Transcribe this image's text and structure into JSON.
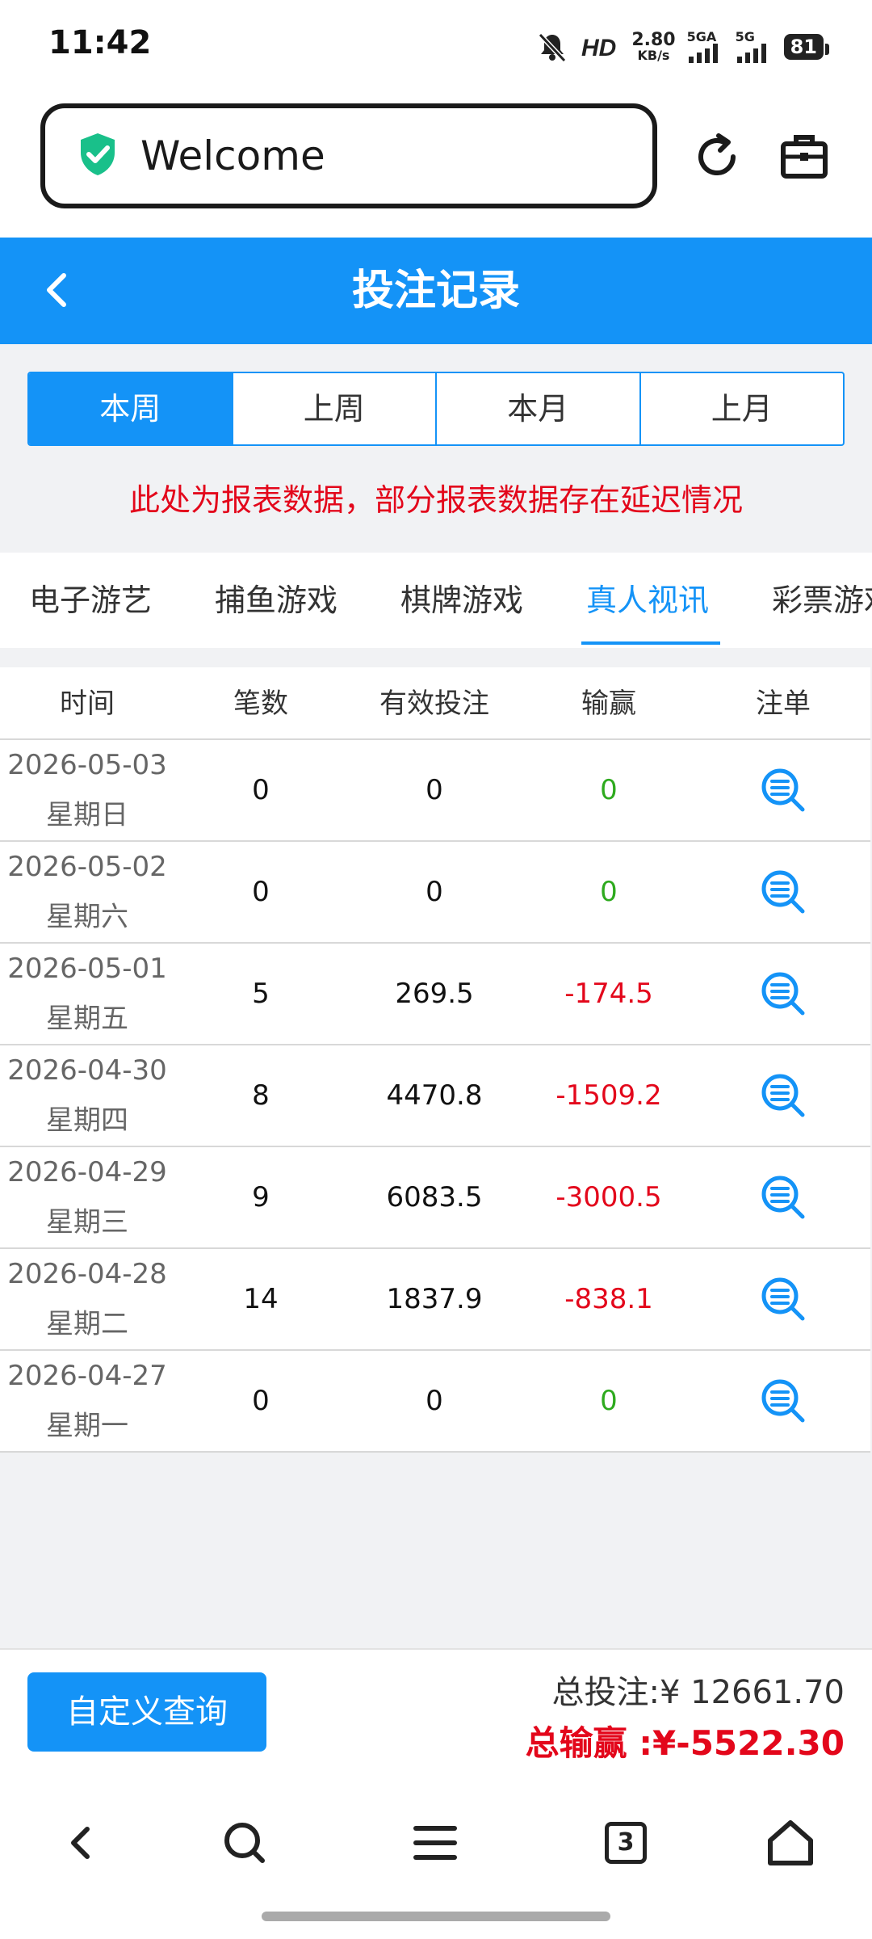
{
  "status_bar": {
    "time": "11:42",
    "net_speed": "2.80",
    "net_unit": "KB/s",
    "sim1_label": "5GA",
    "sim2_label": "5G",
    "battery": "81"
  },
  "browser": {
    "url_text": "Welcome"
  },
  "header": {
    "title": "投注记录"
  },
  "period_tabs": [
    {
      "label": "本周",
      "active": true
    },
    {
      "label": "上周",
      "active": false
    },
    {
      "label": "本月",
      "active": false
    },
    {
      "label": "上月",
      "active": false
    }
  ],
  "notice": "此处为报表数据，部分报表数据存在延迟情况",
  "category_tabs": [
    {
      "label": "电子游艺",
      "active": false
    },
    {
      "label": "捕鱼游戏",
      "active": false
    },
    {
      "label": "棋牌游戏",
      "active": false
    },
    {
      "label": "真人视讯",
      "active": true
    },
    {
      "label": "彩票游戏",
      "active": false
    }
  ],
  "table": {
    "headers": [
      "时间",
      "笔数",
      "有效投注",
      "输赢",
      "注单"
    ],
    "rows": [
      {
        "date": "2026-05-03",
        "weekday": "星期日",
        "count": "0",
        "valid_bet": "0",
        "win_loss": "0",
        "negative": false
      },
      {
        "date": "2026-05-02",
        "weekday": "星期六",
        "count": "0",
        "valid_bet": "0",
        "win_loss": "0",
        "negative": false
      },
      {
        "date": "2026-05-01",
        "weekday": "星期五",
        "count": "5",
        "valid_bet": "269.5",
        "win_loss": "-174.5",
        "negative": true
      },
      {
        "date": "2026-04-30",
        "weekday": "星期四",
        "count": "8",
        "valid_bet": "4470.8",
        "win_loss": "-1509.2",
        "negative": true
      },
      {
        "date": "2026-04-29",
        "weekday": "星期三",
        "count": "9",
        "valid_bet": "6083.5",
        "win_loss": "-3000.5",
        "negative": true
      },
      {
        "date": "2026-04-28",
        "weekday": "星期二",
        "count": "14",
        "valid_bet": "1837.9",
        "win_loss": "-838.1",
        "negative": true
      },
      {
        "date": "2026-04-27",
        "weekday": "星期一",
        "count": "0",
        "valid_bet": "0",
        "win_loss": "0",
        "negative": false
      }
    ]
  },
  "summary": {
    "query_button": "自定义查询",
    "total_bet": "总投注:¥ 12661.70",
    "total_win": "总输赢 :¥-5522.30"
  },
  "nav": {
    "tab_count": "3"
  },
  "colors": {
    "accent": "#1493f7",
    "negative": "#e3071b",
    "positive": "#2eaa1e"
  },
  "icons": [
    "mute-bell-icon",
    "hd-icon",
    "signal-icon",
    "shield-check-icon",
    "refresh-icon",
    "toolbox-icon",
    "back-chevron-icon",
    "list-search-icon",
    "nav-back-icon",
    "search-icon",
    "menu-icon",
    "tabs-icon",
    "home-icon"
  ]
}
